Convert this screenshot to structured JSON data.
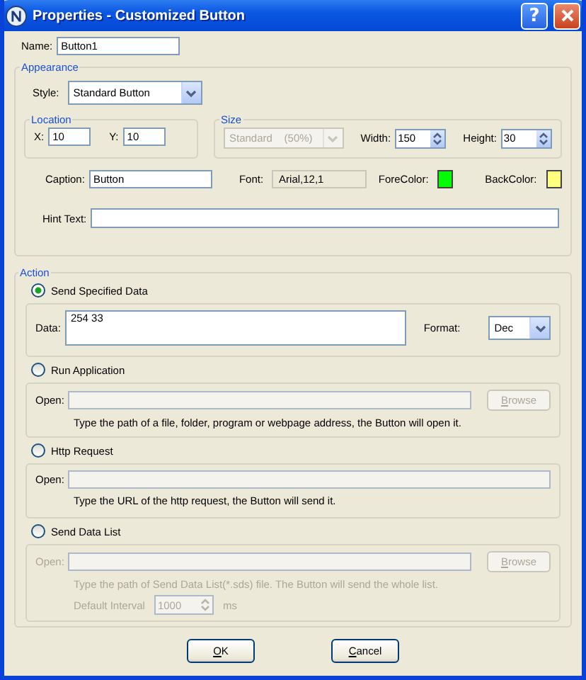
{
  "window": {
    "title": "Properties - Customized Button",
    "help": "?"
  },
  "name": {
    "label": "Name:",
    "value": "Button1"
  },
  "appearance": {
    "title": "Appearance",
    "style": {
      "label": "Style:",
      "value": "Standard Button"
    },
    "location": {
      "title": "Location",
      "x": {
        "label": "X:",
        "value": "10"
      },
      "y": {
        "label": "Y:",
        "value": "10"
      }
    },
    "size": {
      "title": "Size",
      "preset": {
        "value": "Standard    (50%)",
        "disabled": true
      },
      "width": {
        "label": "Width:",
        "value": "150"
      },
      "height": {
        "label": "Height:",
        "value": "30"
      }
    },
    "caption": {
      "label": "Caption:",
      "value": "Button"
    },
    "font": {
      "label": "Font:",
      "value": "Arial,12,1"
    },
    "fore_color": {
      "label": "ForeColor:",
      "color": "#00ff00"
    },
    "back_color": {
      "label": "BackColor:",
      "color": "#ffff80"
    },
    "hint": {
      "label": "Hint Text:"
    }
  },
  "action": {
    "title": "Action",
    "options": [
      {
        "kind": "data",
        "label": "Send Specified Data",
        "selected": true,
        "disabled": false,
        "data": {
          "label": "Data:",
          "value": "254 33"
        },
        "format": {
          "label": "Format:",
          "value": "Dec"
        }
      },
      {
        "kind": "run",
        "label": "Run Application",
        "selected": false,
        "disabled": false,
        "open": {
          "label": "Open:"
        },
        "browse": {
          "label": "Browse",
          "disabled": true
        },
        "note": "Type the path of a file, folder, program or webpage address, the Button will open it."
      },
      {
        "kind": "http",
        "label": "Http Request",
        "selected": false,
        "disabled": false,
        "open": {
          "label": "Open:"
        },
        "note": "Type the URL of the http request, the Button will send it."
      },
      {
        "kind": "list",
        "label": "Send Data List",
        "selected": false,
        "disabled": true,
        "open": {
          "label": "Open:"
        },
        "browse": {
          "label": "Browse",
          "disabled": true
        },
        "note": "Type the path of Send Data List(*.sds)  file. The Button will send the whole list.",
        "interval": {
          "label": "Default Interval",
          "value": "1000",
          "unit": "ms"
        }
      }
    ]
  },
  "buttons": [
    {
      "label": "OK"
    },
    {
      "label": "Cancel"
    }
  ]
}
